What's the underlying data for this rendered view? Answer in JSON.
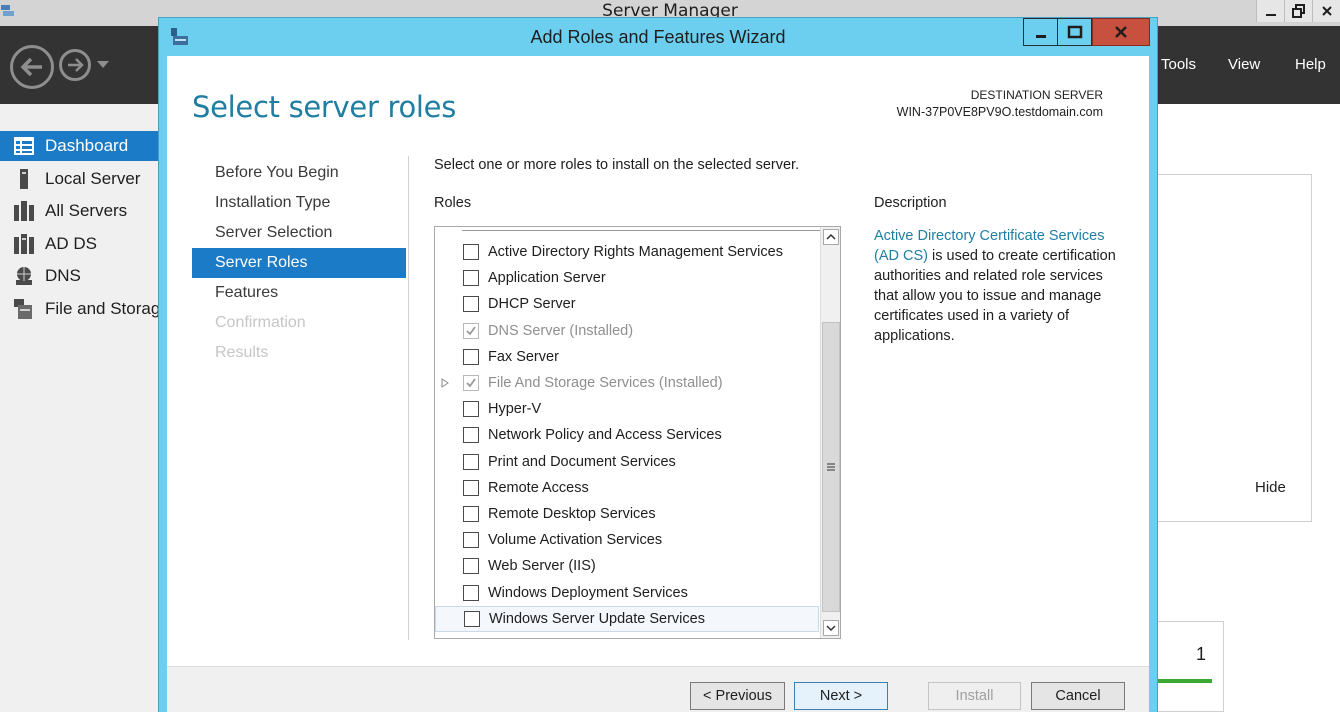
{
  "server_manager": {
    "title": "Server Manager",
    "menu": {
      "tools": "Tools",
      "view": "View",
      "help": "Help"
    },
    "sidebar": [
      {
        "label": "Dashboard",
        "icon": "dashboard-icon",
        "active": true
      },
      {
        "label": "Local Server",
        "icon": "local-server-icon"
      },
      {
        "label": "All Servers",
        "icon": "all-servers-icon"
      },
      {
        "label": "AD DS",
        "icon": "ad-ds-icon"
      },
      {
        "label": "DNS",
        "icon": "dns-icon"
      },
      {
        "label": "File and Storag",
        "icon": "file-storage-icon"
      }
    ],
    "hide_label": "Hide",
    "tile_count": "1",
    "colors": {
      "toolbar": "#333333",
      "accent": "#1c7bc7",
      "status_green": "#3aaa35"
    }
  },
  "wizard": {
    "title": "Add Roles and Features Wizard",
    "page_title": "Select server roles",
    "destination_label": "DESTINATION SERVER",
    "destination_value": "WIN-37P0VE8PV9O.testdomain.com",
    "steps": [
      {
        "label": "Before You Begin",
        "state": "normal"
      },
      {
        "label": "Installation Type",
        "state": "normal"
      },
      {
        "label": "Server Selection",
        "state": "normal"
      },
      {
        "label": "Server Roles",
        "state": "active"
      },
      {
        "label": "Features",
        "state": "normal"
      },
      {
        "label": "Confirmation",
        "state": "disabled"
      },
      {
        "label": "Results",
        "state": "disabled"
      }
    ],
    "instruction": "Select one or more roles to install on the selected server.",
    "roles_label": "Roles",
    "roles": [
      {
        "label": "Active Directory Rights Management Services",
        "checked": false,
        "installed": false,
        "expandable": false
      },
      {
        "label": "Application Server",
        "checked": false,
        "installed": false,
        "expandable": false
      },
      {
        "label": "DHCP Server",
        "checked": false,
        "installed": false,
        "expandable": false
      },
      {
        "label": "DNS Server (Installed)",
        "checked": true,
        "installed": true,
        "expandable": false
      },
      {
        "label": "Fax Server",
        "checked": false,
        "installed": false,
        "expandable": false
      },
      {
        "label": "File And Storage Services (Installed)",
        "checked": true,
        "installed": true,
        "expandable": true
      },
      {
        "label": "Hyper-V",
        "checked": false,
        "installed": false,
        "expandable": false
      },
      {
        "label": "Network Policy and Access Services",
        "checked": false,
        "installed": false,
        "expandable": false
      },
      {
        "label": "Print and Document Services",
        "checked": false,
        "installed": false,
        "expandable": false
      },
      {
        "label": "Remote Access",
        "checked": false,
        "installed": false,
        "expandable": false
      },
      {
        "label": "Remote Desktop Services",
        "checked": false,
        "installed": false,
        "expandable": false
      },
      {
        "label": "Volume Activation Services",
        "checked": false,
        "installed": false,
        "expandable": false
      },
      {
        "label": "Web Server (IIS)",
        "checked": false,
        "installed": false,
        "expandable": false
      },
      {
        "label": "Windows Deployment Services",
        "checked": false,
        "installed": false,
        "expandable": false
      },
      {
        "label": "Windows Server Update Services",
        "checked": false,
        "installed": false,
        "expandable": false,
        "selected": true
      }
    ],
    "description_label": "Description",
    "description_link": "Active Directory Certificate Services (AD CS)",
    "description_text": " is used to create certification authorities and related role services that allow you to issue and manage certificates used in a variety of applications.",
    "buttons": {
      "previous": "< Previous",
      "next": "Next >",
      "install": "Install",
      "cancel": "Cancel"
    },
    "colors": {
      "titlebar": "#6dcff0",
      "close": "#c7503e",
      "title_text": "#1f7ea1",
      "selected_step": "#1c7bc7"
    }
  }
}
